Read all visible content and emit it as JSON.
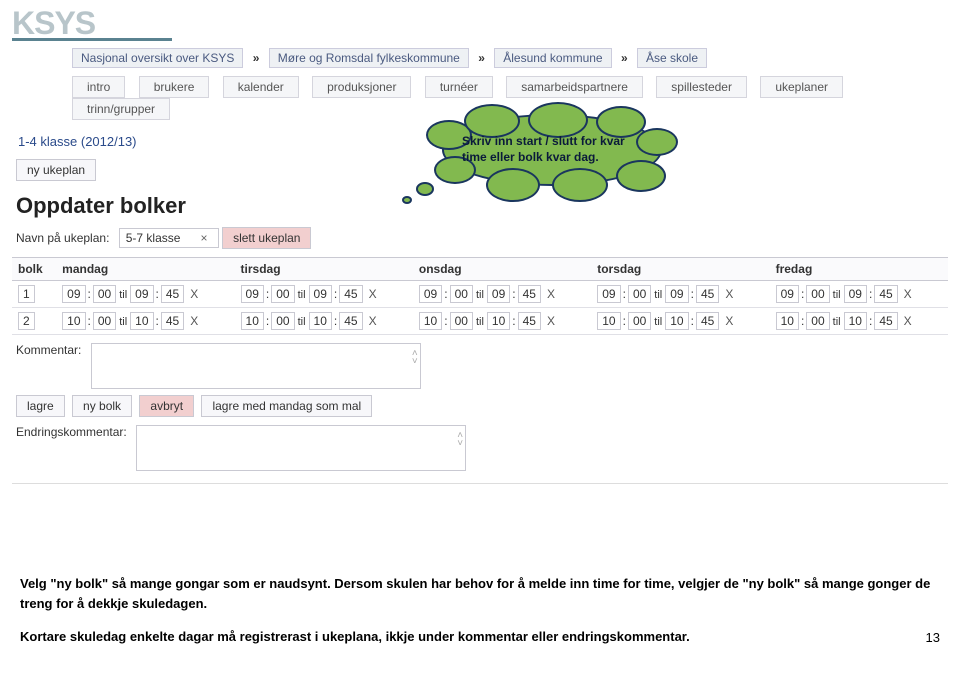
{
  "logo": "KSYS",
  "breadcrumb": {
    "items": [
      "Nasjonal oversikt over KSYS",
      "Møre og Romsdal fylkeskommune",
      "Ålesund kommune",
      "Åse skole"
    ],
    "sep": "»"
  },
  "tabs": [
    "intro",
    "brukere",
    "kalender",
    "produksjoner",
    "turnéer",
    "samarbeidspartnere",
    "spillesteder",
    "ukeplaner",
    "trinn/grupper"
  ],
  "subhead": "1-4 klasse (2012/13)",
  "ny_ukeplan_btn": "ny ukeplan",
  "page_title": "Oppdater bolker",
  "plan_label": "Navn på ukeplan:",
  "plan_value": "5-7 klasse",
  "slett_btn": "slett ukeplan",
  "table": {
    "headers": [
      "bolk",
      "mandag",
      "tirsdag",
      "onsdag",
      "torsdag",
      "fredag"
    ],
    "rows": [
      {
        "bolk": "1",
        "cells": [
          {
            "h1": "09",
            "m1": "00",
            "h2": "09",
            "m2": "45"
          },
          {
            "h1": "09",
            "m1": "00",
            "h2": "09",
            "m2": "45"
          },
          {
            "h1": "09",
            "m1": "00",
            "h2": "09",
            "m2": "45"
          },
          {
            "h1": "09",
            "m1": "00",
            "h2": "09",
            "m2": "45"
          },
          {
            "h1": "09",
            "m1": "00",
            "h2": "09",
            "m2": "45"
          }
        ]
      },
      {
        "bolk": "2",
        "cells": [
          {
            "h1": "10",
            "m1": "00",
            "h2": "10",
            "m2": "45"
          },
          {
            "h1": "10",
            "m1": "00",
            "h2": "10",
            "m2": "45"
          },
          {
            "h1": "10",
            "m1": "00",
            "h2": "10",
            "m2": "45"
          },
          {
            "h1": "10",
            "m1": "00",
            "h2": "10",
            "m2": "45"
          },
          {
            "h1": "10",
            "m1": "00",
            "h2": "10",
            "m2": "45"
          }
        ]
      }
    ],
    "til": "til",
    "x": "X"
  },
  "kommentar_label": "Kommentar:",
  "buttons": {
    "lagre": "lagre",
    "ny_bolk": "ny bolk",
    "avbryt": "avbryt",
    "lagre_mal": "lagre med mandag som mal"
  },
  "endr_label": "Endringskommentar:",
  "callout": "Skriv inn start / slutt for kvar time eller bolk kvar dag.",
  "instr1": "Velg \"ny bolk\" så mange gongar som er naudsynt. Dersom skulen har behov for å melde inn time for time, velgjer de \"ny bolk\" så mange gonger de treng for å dekkje skuledagen.",
  "instr2": "Kortare skuledag enkelte dagar må registrerast i ukeplana, ikkje under kommentar eller endringskommentar.",
  "pagenum": "13"
}
